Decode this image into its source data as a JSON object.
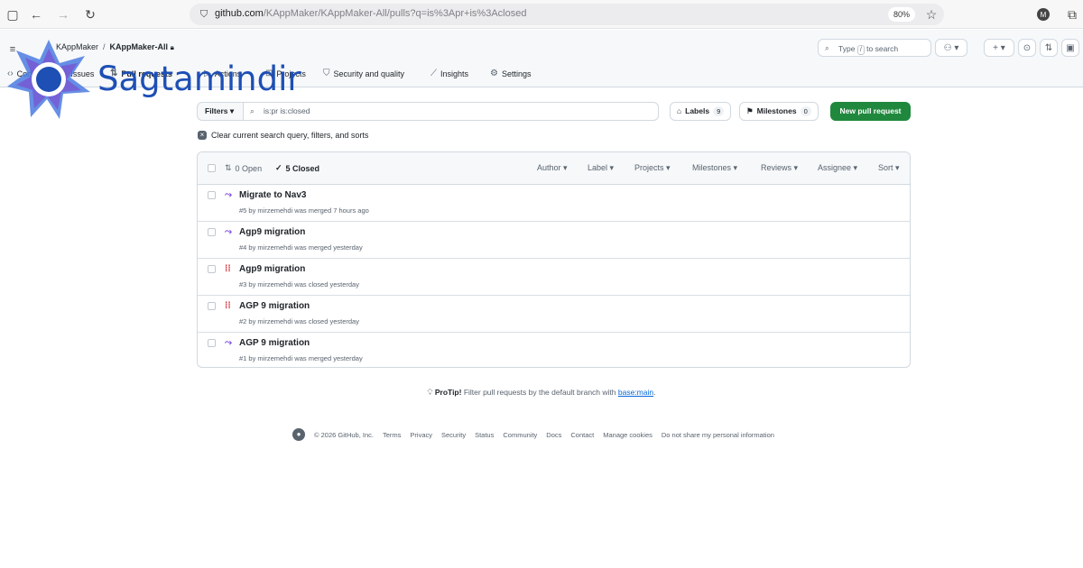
{
  "browser": {
    "url_host": "github.com",
    "url_rest": "/KAppMaker/KAppMaker-All/pulls?q=is%3Apr+is%3Aclosed",
    "zoom": "80%",
    "profile_initial": "M"
  },
  "header": {
    "owner": "KAppMaker",
    "repo": "KAppMaker-All",
    "search_placeholder_pre": "Type",
    "search_key": "/",
    "search_placeholder_post": "to search"
  },
  "repo_nav": [
    {
      "label": "Code"
    },
    {
      "label": "Issues"
    },
    {
      "label": "Pull requests"
    },
    {
      "label": "Actions"
    },
    {
      "label": "Projects"
    },
    {
      "label": "Security and quality"
    },
    {
      "label": "Insights"
    },
    {
      "label": "Settings"
    }
  ],
  "toolbar": {
    "filters_label": "Filters",
    "query": "is:pr is:closed",
    "labels_label": "Labels",
    "labels_count": "9",
    "milestones_label": "Milestones",
    "milestones_count": "0",
    "new_pr_label": "New pull request"
  },
  "clear_text": "Clear current search query, filters, and sorts",
  "list_header": {
    "open_label": "0 Open",
    "closed_label": "5 Closed",
    "filters": [
      "Author",
      "Label",
      "Projects",
      "Milestones",
      "Reviews",
      "Assignee",
      "Sort"
    ]
  },
  "pull_requests": [
    {
      "title": "Migrate to Nav3",
      "meta": "#5 by mirzemehdi was merged 7 hours ago",
      "state": "merged"
    },
    {
      "title": "Agp9 migration",
      "meta": "#4 by mirzemehdi was merged yesterday",
      "state": "merged"
    },
    {
      "title": "Agp9 migration",
      "meta": "#3 by mirzemehdi was closed yesterday",
      "state": "closed"
    },
    {
      "title": "AGP 9 migration",
      "meta": "#2 by mirzemehdi was closed yesterday",
      "state": "closed"
    },
    {
      "title": "AGP 9 migration",
      "meta": "#1 by mirzemehdi was merged yesterday",
      "state": "merged"
    }
  ],
  "protip": {
    "label": "ProTip!",
    "text": "Filter pull requests by the default branch with",
    "link": "base:main",
    "end": "."
  },
  "footer": {
    "copyright": "© 2026 GitHub, Inc.",
    "links": [
      "Terms",
      "Privacy",
      "Security",
      "Status",
      "Community",
      "Docs",
      "Contact",
      "Manage cookies",
      "Do not share my personal information"
    ]
  },
  "watermark": {
    "text": "Sagtamindir"
  },
  "colors": {
    "primary_button": "#1f883d",
    "merged": "#8250df",
    "closed": "#cf222e",
    "link": "#0969da",
    "watermark": "#1d4fb5"
  }
}
